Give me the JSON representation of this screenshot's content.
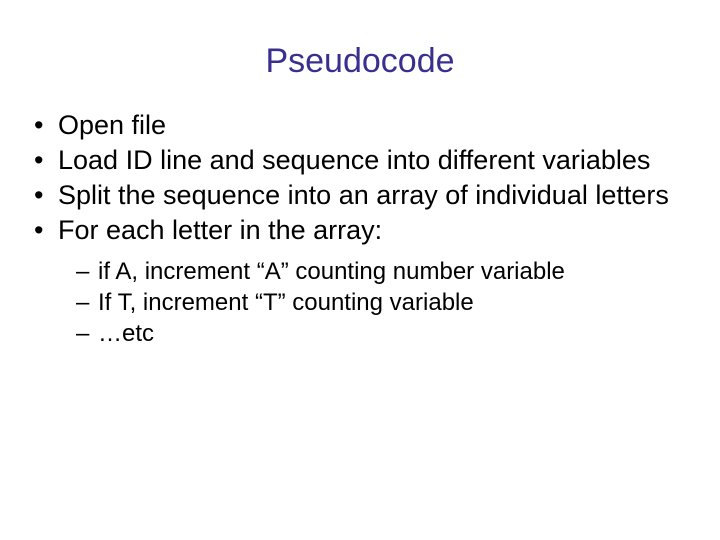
{
  "title": "Pseudocode",
  "bullets": {
    "b1": "Open file",
    "b2": "Load ID line and sequence into different variables",
    "b3": "Split the sequence into an array of individual letters",
    "b4": "For each letter in the array:"
  },
  "sub": {
    "s1": "if A, increment “A” counting number variable",
    "s2": "If T, increment “T” counting variable",
    "s3": "…etc"
  }
}
